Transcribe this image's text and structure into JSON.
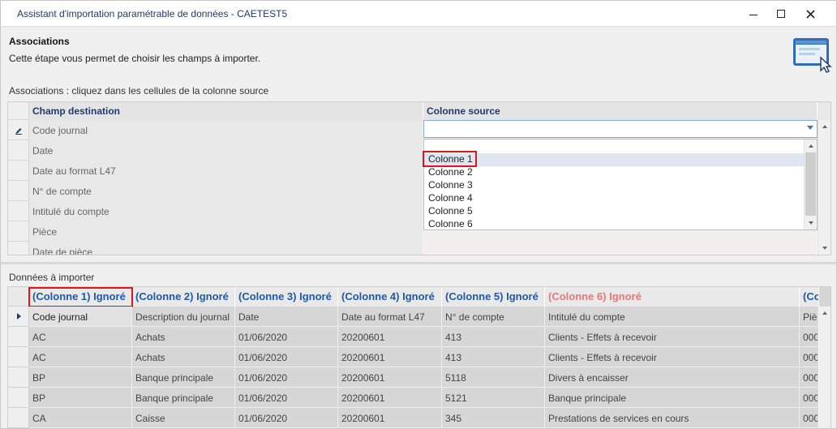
{
  "window": {
    "title": "Assistant d'importation paramétrable de données - CAETEST5"
  },
  "header": {
    "title": "Associations",
    "subtitle": "Cette étape vous permet de choisir les champs à importer."
  },
  "associations": {
    "label": "Associations : cliquez dans les cellules de la colonne source",
    "columns": [
      "Champ destination",
      "Colonne source"
    ],
    "rows": [
      {
        "dest": "Code journal",
        "source": ""
      },
      {
        "dest": "Date",
        "source": ""
      },
      {
        "dest": "Date au format L47",
        "source": ""
      },
      {
        "dest": "N° de compte",
        "source": ""
      },
      {
        "dest": "Intitulé du compte",
        "source": ""
      },
      {
        "dest": "Pièce",
        "source": ""
      },
      {
        "dest": "Date de pièce",
        "source": ""
      }
    ],
    "dropdown": {
      "selected": "Colonne 1",
      "options": [
        "Colonne 1",
        "Colonne 2",
        "Colonne 3",
        "Colonne 4",
        "Colonne 5",
        "Colonne 6"
      ]
    }
  },
  "data_grid": {
    "label": "Données à importer",
    "columns": [
      {
        "label": "(Colonne 1) Ignoré",
        "ignored_style": false
      },
      {
        "label": "(Colonne 2) Ignoré",
        "ignored_style": false
      },
      {
        "label": "(Colonne 3) Ignoré",
        "ignored_style": false
      },
      {
        "label": "(Colonne 4) Ignoré",
        "ignored_style": false
      },
      {
        "label": "(Colonne 5) Ignoré",
        "ignored_style": false
      },
      {
        "label": "(Colonne 6) Ignoré",
        "ignored_style": true
      },
      {
        "label": "(Colo",
        "ignored_style": false
      }
    ],
    "rows": [
      [
        "Code journal",
        "Description du journal",
        "Date",
        "Date au format L47",
        "N° de compte",
        "Intitulé du compte",
        "Piè"
      ],
      [
        "AC",
        "Achats",
        "01/06/2020",
        "20200601",
        "413",
        "Clients - Effets à recevoir",
        "000"
      ],
      [
        "AC",
        "Achats",
        "01/06/2020",
        "20200601",
        "413",
        "Clients - Effets à recevoir",
        "000"
      ],
      [
        "BP",
        "Banque principale",
        "01/06/2020",
        "20200601",
        "5118",
        "Divers à encaisser",
        "000"
      ],
      [
        "BP",
        "Banque principale",
        "01/06/2020",
        "20200601",
        "5121",
        "Banque principale",
        "000"
      ],
      [
        "CA",
        "Caisse",
        "01/06/2020",
        "20200601",
        "345",
        "Prestations de services en cours",
        "000"
      ]
    ]
  },
  "colors": {
    "title_blue": "#1f3b6e",
    "header_blue": "#1f5aa8",
    "ignored_red": "#e07a7a",
    "highlight_red": "#e0141e"
  }
}
